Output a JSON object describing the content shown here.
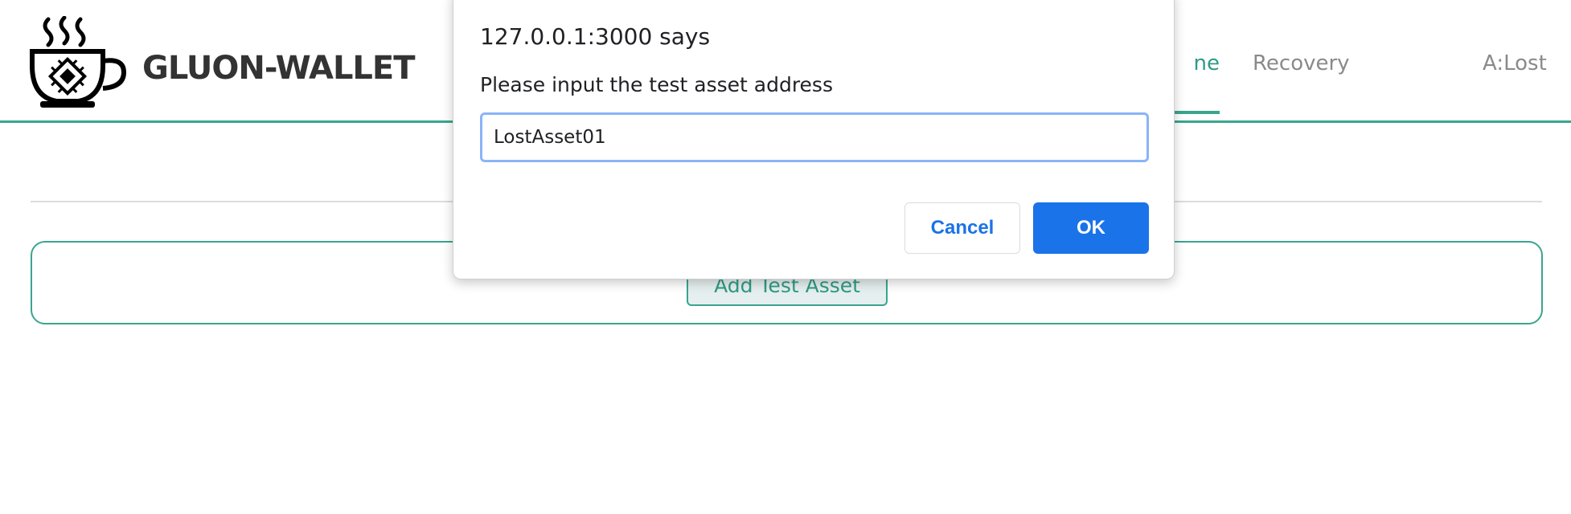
{
  "header": {
    "brand": "GLUON-WALLET",
    "logo_icon": "coffee-cup-chip-icon",
    "nav": {
      "home_fragment": "ne",
      "recovery": "Recovery",
      "alost": "A:Lost"
    }
  },
  "main": {
    "add_test_asset_label": "Add Test Asset"
  },
  "dialog": {
    "title": "127.0.0.1:3000 says",
    "message": "Please input the test asset address",
    "input_value": "LostAsset01",
    "cancel_label": "Cancel",
    "ok_label": "OK"
  },
  "colors": {
    "accent": "#3aa58f",
    "primary_button": "#1a73e8",
    "focus_ring": "#8ab4f8"
  }
}
